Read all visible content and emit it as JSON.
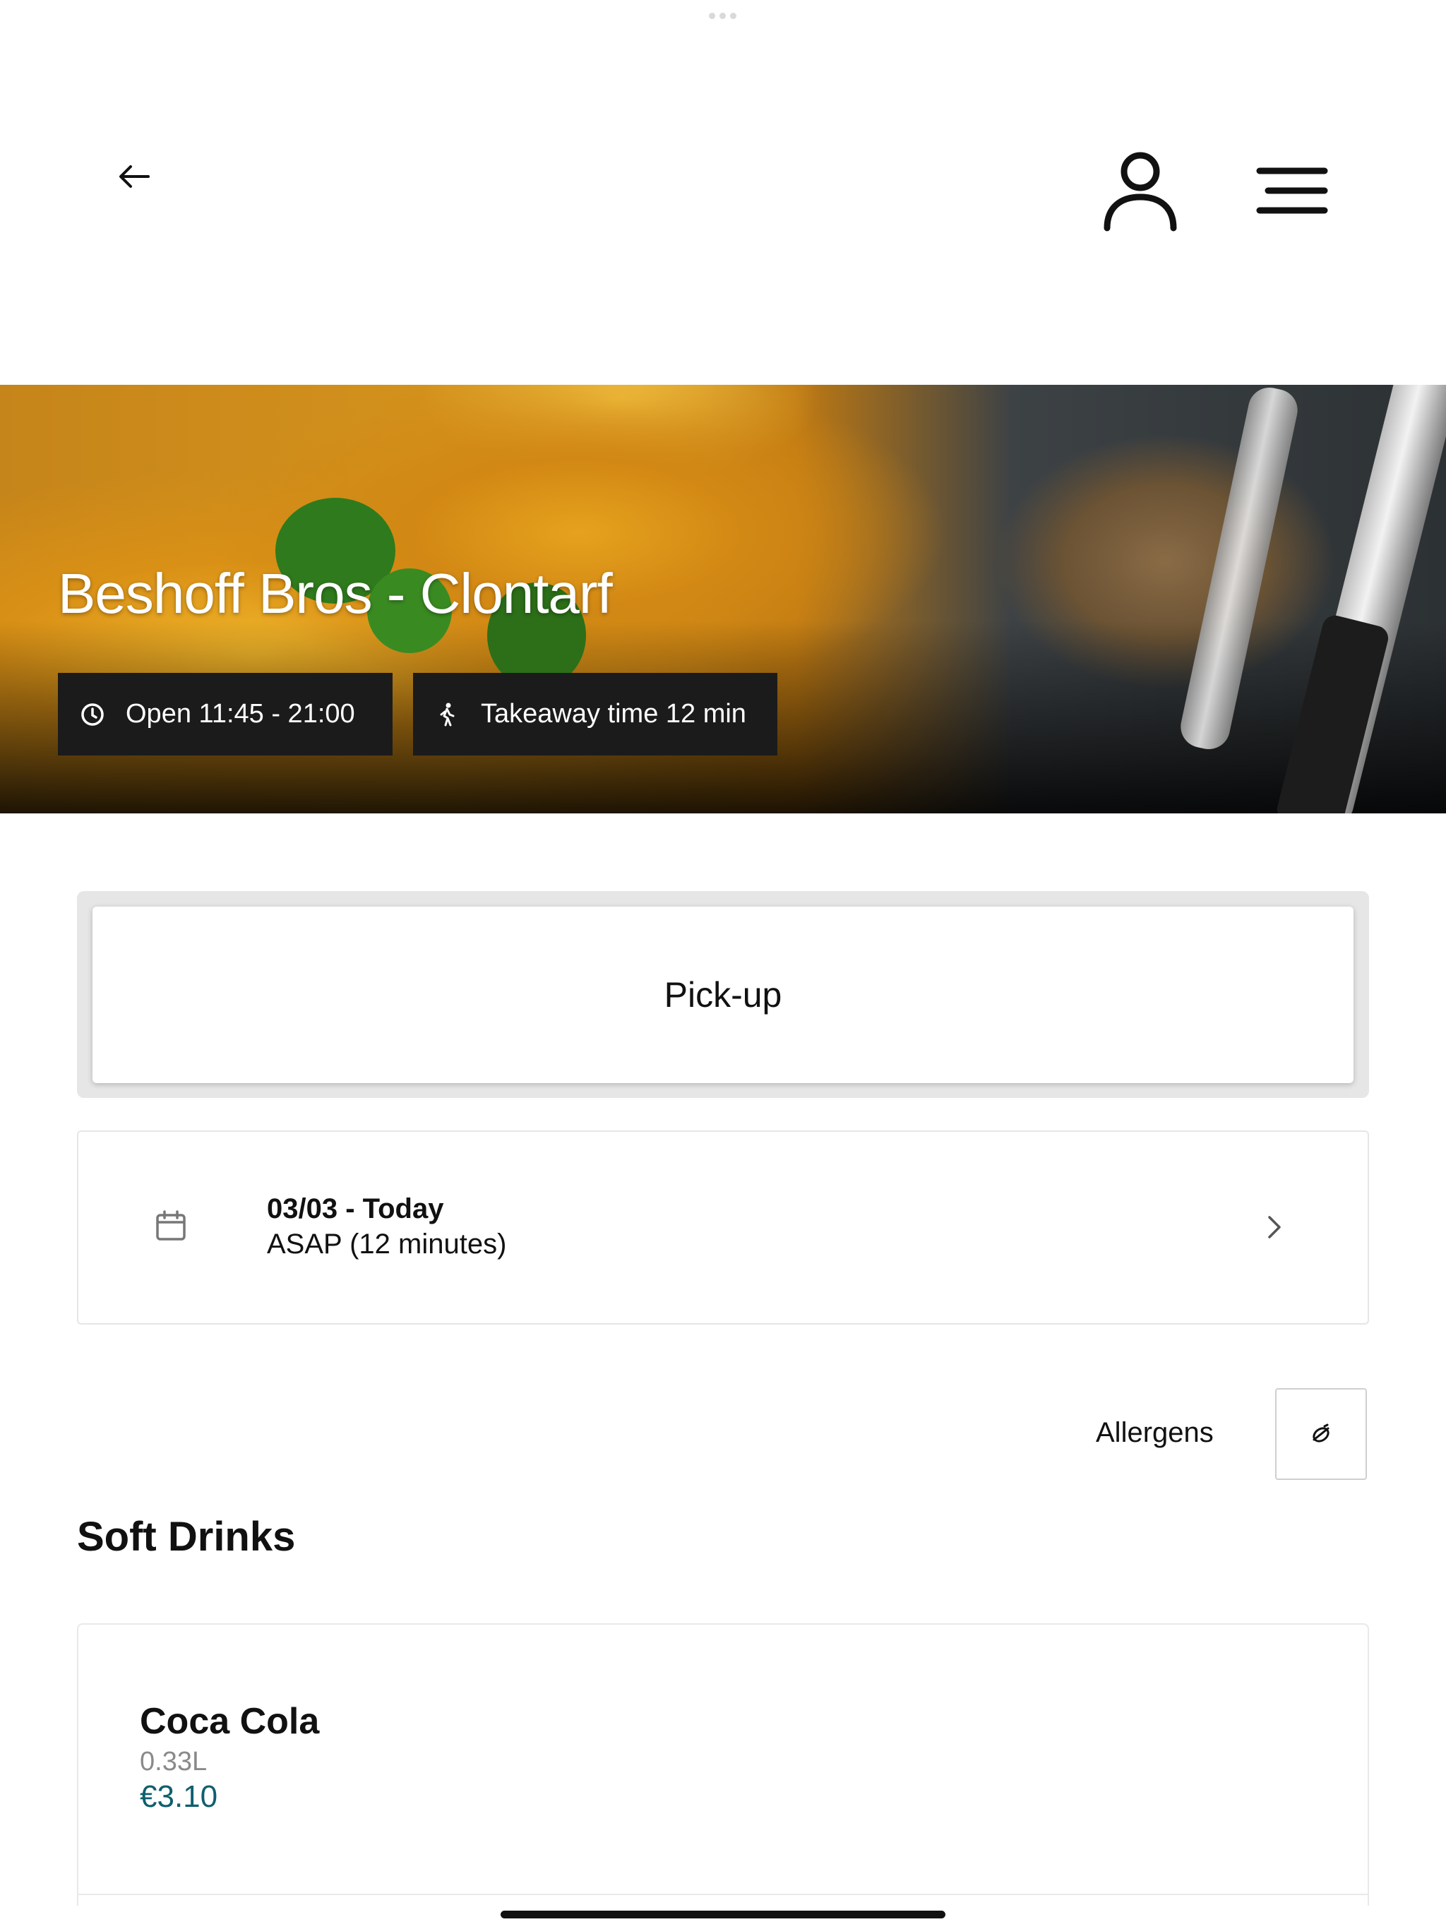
{
  "header": {
    "back_icon": "arrow-left-icon",
    "account_icon": "user-icon",
    "menu_icon": "hamburger-menu-icon"
  },
  "hero": {
    "title": "Beshoff Bros - Clontarf",
    "open_chip": {
      "icon": "clock-icon",
      "label": "Open 11:45 - 21:00"
    },
    "takeaway_chip": {
      "icon": "walking-person-icon",
      "label": "Takeaway time 12 min"
    }
  },
  "order_mode": {
    "selected_label": "Pick-up"
  },
  "schedule": {
    "icon": "calendar-icon",
    "date_label": "03/03 - Today",
    "time_label": "ASAP (12 minutes)",
    "chevron_icon": "chevron-right-icon"
  },
  "allergens": {
    "label": "Allergens",
    "button_icon": "allergen-filter-icon"
  },
  "menu_section": {
    "title": "Soft Drinks",
    "products": [
      {
        "name": "Coca Cola",
        "size": "0.33L",
        "price": "€3.10"
      }
    ]
  },
  "colors": {
    "price": "#0f5f6e",
    "chip_bg": "#1b1b1b",
    "toggle_bg": "#e6e6e6"
  }
}
